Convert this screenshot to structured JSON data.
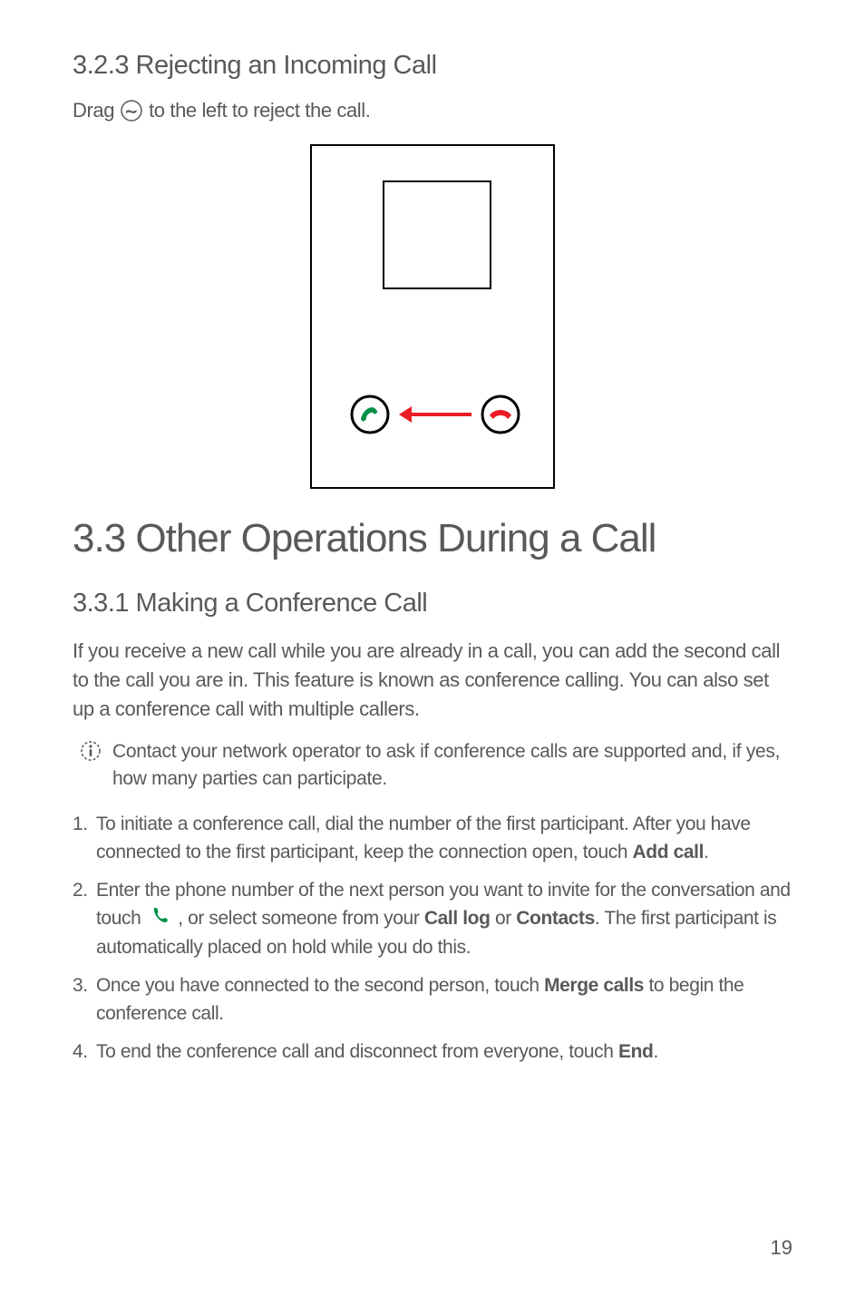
{
  "section_323": {
    "heading": "3.2.3  Rejecting an Incoming Call",
    "drag_prefix": "Drag ",
    "drag_suffix": " to the left to reject the call."
  },
  "section_33": {
    "heading": "3.3  Other Operations During a Call"
  },
  "section_331": {
    "heading": "3.3.1  Making a Conference Call",
    "intro": "If you receive a new call while you are already in a call, you can add the second call to the call you are in. This feature is known as conference calling. You can also set up a conference call with multiple callers.",
    "note": "Contact your network operator to ask if conference calls are supported and, if yes, how many parties can participate.",
    "steps": {
      "s1_a": "To initiate a conference call, dial the number of the first participant. After you have connected to the first participant, keep the connection open, touch ",
      "s1_bold": "Add call",
      "s1_b": ".",
      "s2_a": "Enter the phone number of the next person you want to invite for the conversation and touch ",
      "s2_b": " , or select someone from your ",
      "s2_bold1": "Call log",
      "s2_c": " or ",
      "s2_bold2": "Contacts",
      "s2_d": ". The first participant is automatically placed on hold while you do this.",
      "s3_a": "Once you have connected to the second person, touch ",
      "s3_bold": "Merge calls",
      "s3_b": " to begin the conference call.",
      "s4_a": "To end the conference call and disconnect from everyone, touch ",
      "s4_bold": "End",
      "s4_b": "."
    }
  },
  "page_number": "19"
}
